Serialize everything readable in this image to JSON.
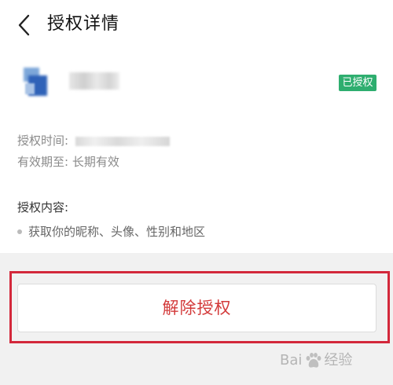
{
  "header": {
    "title": "授权详情"
  },
  "app": {
    "status_badge": "已授权"
  },
  "details": {
    "time_label": "授权时间: ",
    "valid_label": "有效期至: ",
    "valid_value": "长期有效"
  },
  "permissions": {
    "heading": "授权内容:",
    "items": [
      "获取你的昵称、头像、性别和地区"
    ]
  },
  "actions": {
    "revoke_label": "解除授权"
  },
  "watermark": {
    "brand_prefix": "Bai",
    "brand_suffix": "经验"
  },
  "colors": {
    "badge": "#2eae6f",
    "revoke_text": "#d33a3a",
    "highlight_outline": "#d3283b"
  }
}
